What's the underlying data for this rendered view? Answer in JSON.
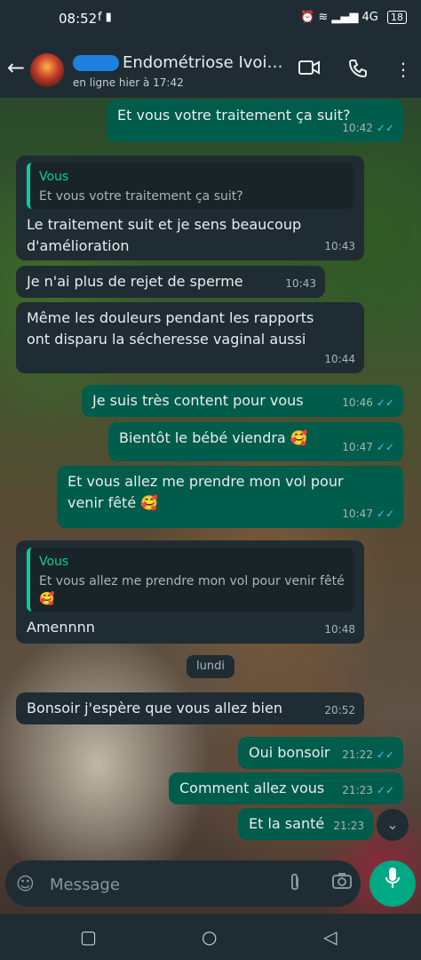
{
  "status_bar": {
    "time": "08:52",
    "left_icons": [
      "facebook-icon",
      "sim-icon"
    ],
    "right_text": "4G",
    "battery": "18"
  },
  "header": {
    "back_icon": "arrow-left-icon",
    "title": "Endométriose Ivoi…",
    "subtitle": "en ligne hier à 17:42",
    "icons": [
      "video-call-icon",
      "phone-call-icon",
      "more-vert-icon"
    ]
  },
  "messages": [
    {
      "dir": "out",
      "text": "Et vous votre traitement ça suit?",
      "time": "10:42",
      "read": true
    },
    {
      "dir": "in",
      "quote_author": "Vous",
      "quote_text": "Et vous votre traitement ça suit?",
      "text": "Le traitement suit et je sens beaucoup d'amélioration",
      "time": "10:43"
    },
    {
      "dir": "in",
      "text": "Je n'ai plus de rejet de sperme",
      "time": "10:43"
    },
    {
      "dir": "in",
      "text": "Même les douleurs pendant les rapports ont disparu la sécheresse vaginal aussi",
      "time": "10:44"
    },
    {
      "dir": "out",
      "text": "Je suis très content pour vous",
      "time": "10:46",
      "read": true
    },
    {
      "dir": "out",
      "text": "Bientôt le bébé viendra 🥰",
      "time": "10:47",
      "read": true
    },
    {
      "dir": "out",
      "text": "Et vous allez me prendre mon vol pour venir fêté 🥰",
      "time": "10:47",
      "read": true
    },
    {
      "dir": "in",
      "quote_author": "Vous",
      "quote_text": "Et vous allez me prendre mon vol pour venir fêté 🥰",
      "text": "Amennnn",
      "time": "10:48"
    },
    {
      "dir": "in",
      "text": "Bonsoir j'espère que vous allez bien",
      "time": "20:52"
    },
    {
      "dir": "out",
      "text": "Oui bonsoir",
      "time": "21:22",
      "read": true
    },
    {
      "dir": "out",
      "text": "Comment allez vous",
      "time": "21:23",
      "read": true
    },
    {
      "dir": "out",
      "text": "Et la santé",
      "time": "21:23",
      "read": false
    }
  ],
  "day_separator": "lundi",
  "composer": {
    "placeholder": "Message",
    "icons": [
      "emoji-icon",
      "attach-icon",
      "camera-icon"
    ],
    "mic_icon": "mic-icon"
  },
  "nav_bar": {
    "icons": [
      "recent-apps-icon",
      "home-icon",
      "back-nav-icon"
    ]
  },
  "colors": {
    "header_bg": "#1f2c33",
    "incoming_bubble": "#1f2c33",
    "outgoing_bubble": "#005c4b",
    "accent": "#00a884",
    "read_ticks": "#53bdeb"
  }
}
